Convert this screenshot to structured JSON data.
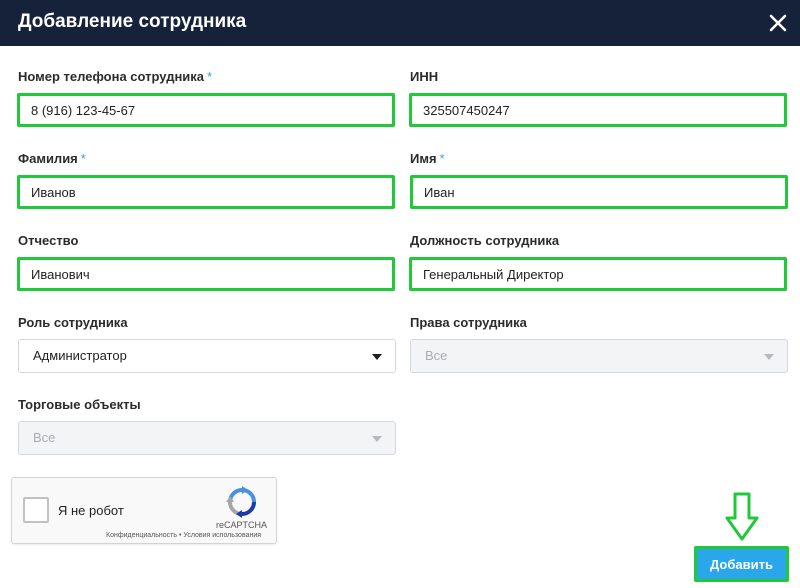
{
  "dialog": {
    "title": "Добавление сотрудника",
    "close_icon": "close-icon"
  },
  "fields": {
    "phone": {
      "label": "Номер телефона сотрудника",
      "required": "*",
      "value": "8 (916) 123-45-67"
    },
    "inn": {
      "label": "ИНН",
      "value": "325507450247"
    },
    "last_name": {
      "label": "Фамилия",
      "required": "*",
      "value": "Иванов"
    },
    "first_name": {
      "label": "Имя",
      "required": "*",
      "value": "Иван"
    },
    "patronymic": {
      "label": "Отчество",
      "value": "Иванович"
    },
    "position": {
      "label": "Должность сотрудника",
      "value": "Генеральный Директор"
    },
    "role": {
      "label": "Роль сотрудника",
      "value": "Администратор"
    },
    "rights": {
      "label": "Права сотрудника",
      "value": "Все"
    },
    "outlets": {
      "label": "Торговые объекты",
      "value": "Все"
    }
  },
  "captcha": {
    "label": "Я не робот",
    "brand": "reCAPTCHA",
    "links": "Конфиденциальность • Условия использования",
    "icon": "recaptcha-icon"
  },
  "actions": {
    "submit_label": "Добавить"
  },
  "colors": {
    "header_bg": "#16213a",
    "highlight": "#21c93a",
    "accent": "#2aa7ea",
    "required": "#3aa0e0"
  }
}
